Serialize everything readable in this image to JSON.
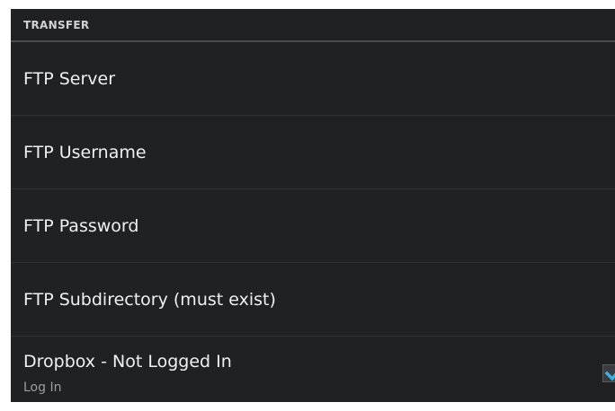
{
  "section": {
    "header": "TRANSFER"
  },
  "preferences": [
    {
      "title": "FTP Server"
    },
    {
      "title": "FTP Username"
    },
    {
      "title": "FTP Password"
    },
    {
      "title": "FTP Subdirectory (must exist)"
    },
    {
      "title": "Dropbox - Not Logged In",
      "summary": "Log In",
      "checked": true
    }
  ],
  "colors": {
    "background": "#1f2123",
    "accent_check": "#33b5e5",
    "divider": "#303336"
  }
}
